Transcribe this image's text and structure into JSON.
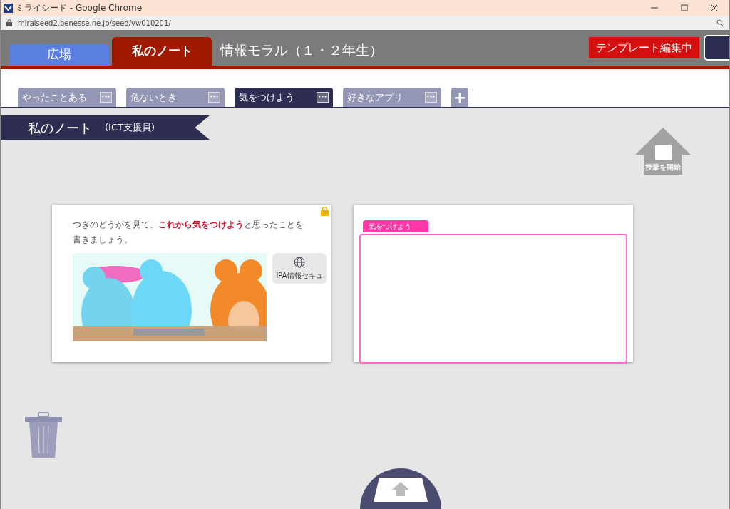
{
  "window": {
    "title": "ミライシード - Google Chrome"
  },
  "address_bar": {
    "url": "miraiseed2.benesse.ne.jp/seed/vw010201/"
  },
  "header": {
    "nav": [
      {
        "label": "広場",
        "selected": false
      },
      {
        "label": "私のノート",
        "selected": true
      }
    ],
    "subject": "情報モラル（１・２年生）",
    "template_badge": "テンプレート編集中"
  },
  "tabs": [
    {
      "label": "やったことある",
      "selected": false,
      "menu": "•••"
    },
    {
      "label": "危ないとき",
      "selected": false,
      "menu": "•••"
    },
    {
      "label": "気をつけよう",
      "selected": true,
      "menu": "•••"
    },
    {
      "label": "好きなアプリ",
      "selected": false,
      "menu": "•••"
    }
  ],
  "add_tab": "+",
  "ribbon": {
    "title": "私のノート",
    "role": "(ICT支援員)"
  },
  "start_lesson": "授業を開始",
  "question_card": {
    "prompt": "つぎのどうがを見て、**これから気をつけよう**と思ったことを書きましょう。",
    "link": "IPA情報セキュ",
    "locked": true
  },
  "answer_card": {
    "label": "気をつけよう",
    "color": "#ff3aa8"
  }
}
